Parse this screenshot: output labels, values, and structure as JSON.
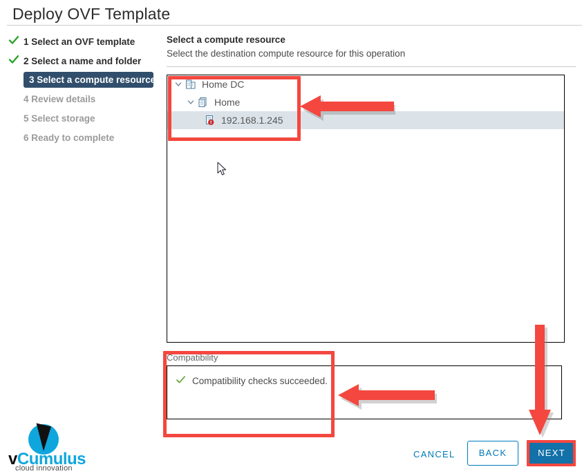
{
  "window": {
    "title": "Deploy OVF Template"
  },
  "steps": [
    {
      "number": "1",
      "label": "1 Select an OVF template",
      "state": "done"
    },
    {
      "number": "2",
      "label": "2 Select a name and folder",
      "state": "done"
    },
    {
      "number": "3",
      "label": "3 Select a compute resource",
      "state": "active"
    },
    {
      "number": "4",
      "label": "4 Review details",
      "state": "pending"
    },
    {
      "number": "5",
      "label": "5 Select storage",
      "state": "pending"
    },
    {
      "number": "6",
      "label": "6 Ready to complete",
      "state": "pending"
    }
  ],
  "section": {
    "title": "Select a compute resource",
    "subtitle": "Select the destination compute resource for this operation"
  },
  "tree": {
    "nodes": [
      {
        "label": "Home DC",
        "icon": "datacenter-icon",
        "expanded": true,
        "selected": false,
        "indent": 1
      },
      {
        "label": "Home",
        "icon": "cluster-icon",
        "expanded": true,
        "selected": false,
        "indent": 2
      },
      {
        "label": "192.168.1.245",
        "icon": "host-warning-icon",
        "expanded": null,
        "selected": true,
        "indent": 3
      }
    ]
  },
  "compatibility": {
    "legend": "Compatibility",
    "message": "Compatibility checks succeeded.",
    "status_icon": "green-check-icon"
  },
  "footer": {
    "cancel_label": "CANCEL",
    "back_label": "BACK",
    "next_label": "NEXT"
  },
  "brand": {
    "name_prefix": "v",
    "name_main": "Cumulus",
    "tagline": "cloud innovation"
  },
  "colors": {
    "accent_blue": "#1271a8",
    "link_blue": "#0079b8",
    "active_step_bg": "#314f6c",
    "annotation_red": "#f4473f",
    "selected_row": "#dbe3e9",
    "success_green": "#5aa02c",
    "brand_cyan": "#0fa6de"
  }
}
